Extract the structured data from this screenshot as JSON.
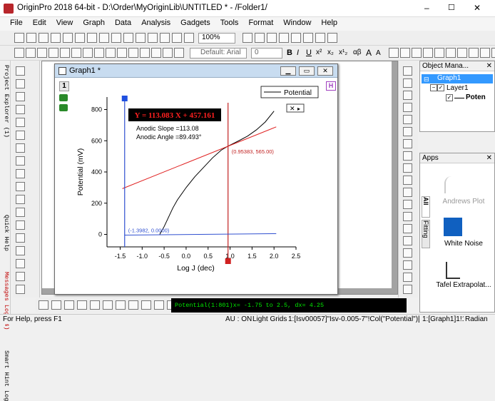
{
  "window": {
    "title": "OriginPro 2018 64-bit - D:\\Order\\MyOriginLib\\UNTITLED * - /Folder1/",
    "controls": [
      "–",
      "☐",
      "✕"
    ]
  },
  "menu": [
    "File",
    "Edit",
    "View",
    "Graph",
    "Data",
    "Analysis",
    "Gadgets",
    "Tools",
    "Format",
    "Window",
    "Help"
  ],
  "toolbar": {
    "zoom": "100%",
    "font": "Default: Arial",
    "font_size": "0",
    "format_buttons": [
      "B",
      "I",
      "U",
      "x²",
      "x₂",
      "x¹₂",
      "αβ",
      "A",
      "A"
    ]
  },
  "sidebar_tabs": [
    "Project Explorer (1)",
    "Quick Help",
    "Messages Log (4)",
    "Smart Hint Log"
  ],
  "graph_window": {
    "title": "Graph1 *",
    "layer": "1",
    "h_badge": "H"
  },
  "chart_data": {
    "type": "line",
    "x": [
      -0.6,
      -0.5,
      -0.4,
      -0.3,
      -0.2,
      0.0,
      0.2,
      0.4,
      0.6,
      0.8,
      0.95,
      1.2,
      1.4,
      1.6,
      1.8,
      2.0
    ],
    "series": [
      {
        "name": "Potential",
        "values": [
          0,
          50,
          110,
          170,
          220,
          300,
          370,
          430,
          490,
          540,
          565,
          600,
          630,
          670,
          720,
          790
        ]
      }
    ],
    "fit_line": {
      "slope": 113.08,
      "intercept": 457.16,
      "x_range": [
        -1.45,
        2.05
      ]
    },
    "xlim": [
      -1.8,
      2.5
    ],
    "ylim": [
      -80,
      880
    ],
    "xticks": [
      "-1.5",
      "-1.0",
      "-0.5",
      "0.0",
      "0.5",
      "1.0",
      "1.5",
      "2.0",
      "2.5"
    ],
    "yticks": [
      "0",
      "200",
      "400",
      "600",
      "800"
    ],
    "xlabel": "Log J (dec)",
    "ylabel": "Potential (mV)",
    "legend": "Potential",
    "equation": "Y = 113.083 X + 457.161",
    "annotations": [
      "Anodic Slope =113.08",
      "Anodic Angle =89.493°"
    ],
    "cursor1_label": "(-1.3982, 0.0000)",
    "cursor2_label": "(0.95383, 565.00)",
    "cursor1_x": -1.3982,
    "cursor2_x": 0.95383
  },
  "object_manager": {
    "title": "Object Mana...",
    "graph": "Graph1",
    "layer": "Layer1",
    "plot": "Poten"
  },
  "apps": {
    "title": "Apps",
    "tabs": [
      "All",
      "Fitting"
    ],
    "items": [
      "Andrews Plot",
      "White Noise",
      "Tafel Extrapolat..."
    ]
  },
  "script_window": {
    "text": "Potential(1:801)x= -1.75 to 2.5, dx= 4.25"
  },
  "status": {
    "help": "For Help, press F1",
    "au": "AU : ON",
    "grid": "Light Grids",
    "col": "1:[Isv00057]\"Isv-0.005-7\"!Col(\"Potential\")[1:801]",
    "graph": "1:[Graph1]1!1",
    "unit": "Radian"
  }
}
